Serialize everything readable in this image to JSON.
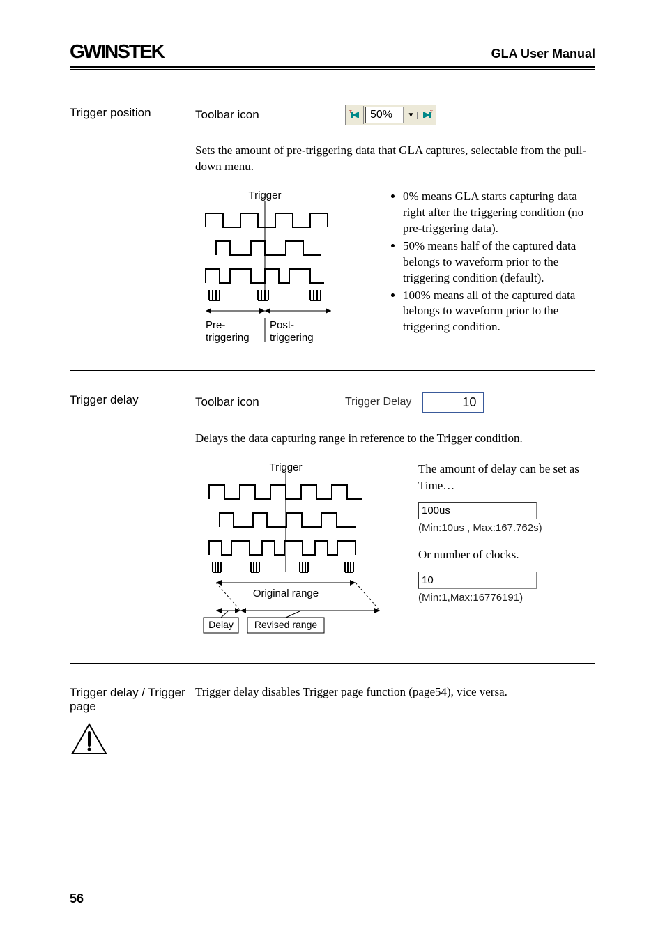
{
  "header": {
    "logo": "GWINSTEK",
    "title": "GLA User Manual"
  },
  "trigger_position": {
    "heading": "Trigger position",
    "toolbar_label": "Toolbar icon",
    "value": "50%",
    "description": "Sets the amount of pre-triggering data that GLA captures, selectable from the pull-down menu.",
    "diagram": {
      "trigger_label": "Trigger",
      "pre_label": "Pre-\ntriggering",
      "post_label": "Post-\ntriggering"
    },
    "bullets": [
      "0% means GLA starts capturing data right after the triggering condition (no pre-triggering data).",
      "50% means half of the captured data belongs to waveform prior to the triggering condition (default).",
      "100% means all of the captured data belongs to waveform prior to the triggering condition."
    ]
  },
  "trigger_delay": {
    "heading": "Trigger delay",
    "toolbar_label": "Toolbar icon",
    "widget_label": "Trigger Delay",
    "widget_value": "10",
    "description": "Delays the data capturing range in reference to the Trigger condition.",
    "diagram": {
      "trigger_label": "Trigger",
      "original_label": "Original range",
      "delay_label": "Delay",
      "revised_label": "Revised range"
    },
    "right_text_1": "The amount of delay can be set as Time…",
    "time_value": "100us",
    "time_hint": "(Min:10us , Max:167.762s)",
    "right_text_2": "Or number of clocks.",
    "clock_value": "10",
    "clock_hint": "(Min:1,Max:16776191)"
  },
  "trigger_note": {
    "heading": "Trigger delay / Trigger page",
    "text": "Trigger delay disables Trigger page function (page54), vice versa."
  },
  "page_number": "56"
}
